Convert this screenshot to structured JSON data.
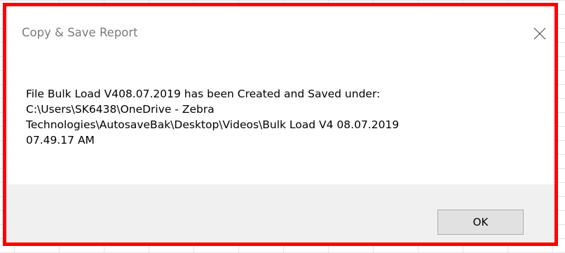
{
  "dialog": {
    "title": "Copy & Save Report",
    "close_icon": "close-icon",
    "message_lines": [
      "File Bulk Load V408.07.2019 has been Created and Saved under:",
      "C:\\Users\\SK6438\\OneDrive - Zebra",
      "Technologies\\AutosaveBak\\Desktop\\Videos\\Bulk Load V4 08.07.2019",
      "07.49.17 AM"
    ],
    "ok_label": "OK"
  },
  "colors": {
    "highlight_border": "#ff0000",
    "footer_bg": "#f0f0f0",
    "button_bg": "#e1e1e1",
    "title_text": "#7a7a7a"
  }
}
